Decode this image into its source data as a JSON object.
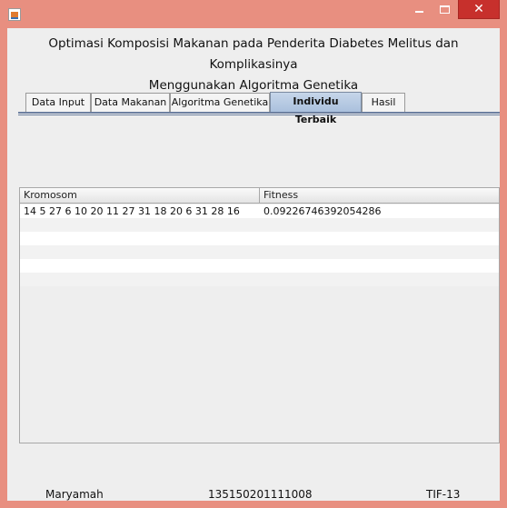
{
  "window": {
    "title": "",
    "icons": {
      "app": "java-app-icon",
      "minimize": "minimize-icon",
      "maximize": "maximize-icon",
      "close": "close-icon"
    },
    "close_glyph": "✕",
    "colors": {
      "frame": "#e88f80",
      "close_button": "#c7302c",
      "client": "#eeeeee",
      "selected_tab": "#b7cbe3"
    }
  },
  "heading": {
    "line1": "Optimasi Komposisi Makanan pada Penderita Diabetes Melitus dan Komplikasinya",
    "line2": "Menggunakan Algoritma Genetika"
  },
  "tabs": [
    {
      "label": "Data Input",
      "selected": false
    },
    {
      "label": "Data Makanan",
      "selected": false
    },
    {
      "label": "Algoritma Genetika",
      "selected": false
    },
    {
      "label": "Individu Terbaik",
      "selected": true
    },
    {
      "label": "Hasil",
      "selected": false
    }
  ],
  "table": {
    "columns": [
      "Kromosom",
      "Fitness"
    ],
    "rows": [
      [
        "14 5 27 6 10 20 11 27 31 18 20 6 31 28 16",
        "0.09226746392054286"
      ],
      [
        "",
        ""
      ],
      [
        "",
        ""
      ],
      [
        "",
        ""
      ],
      [
        "",
        ""
      ],
      [
        "",
        ""
      ]
    ]
  },
  "footer": {
    "name": "Maryamah",
    "nim": "135150201111008",
    "class": "TIF-13"
  }
}
